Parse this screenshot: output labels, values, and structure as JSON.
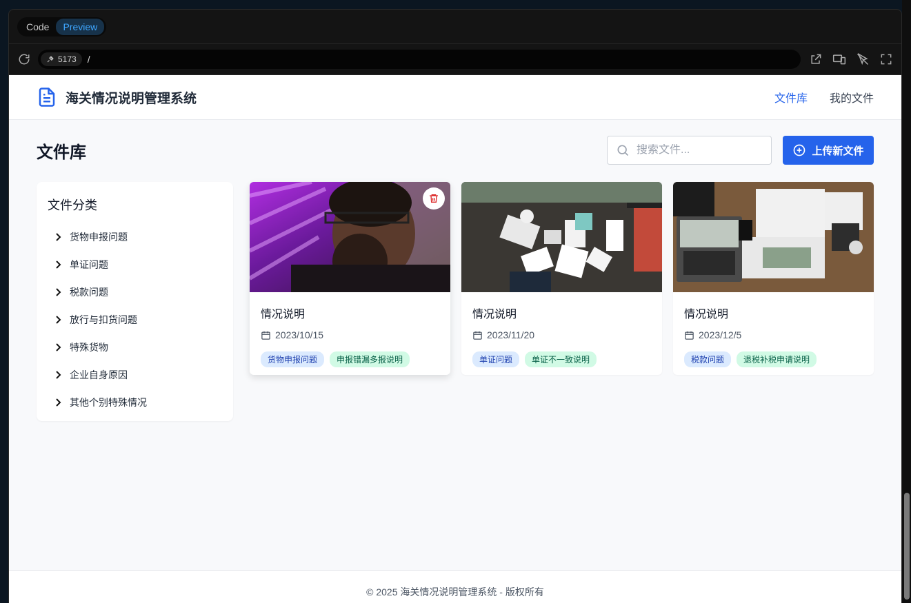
{
  "browser": {
    "tabs": [
      "Code",
      "Preview"
    ],
    "active_tab": "Preview",
    "port": "5173",
    "path": "/"
  },
  "header": {
    "title": "海关情况说明管理系统",
    "nav": [
      "文件库",
      "我的文件"
    ]
  },
  "page": {
    "title": "文件库",
    "search_placeholder": "搜索文件...",
    "upload_label": "上传新文件"
  },
  "sidebar": {
    "title": "文件分类",
    "items": [
      "货物申报问题",
      "单证问题",
      "税款问题",
      "放行与扣货问题",
      "特殊货物",
      "企业自身原因",
      "其他个别特殊情况"
    ]
  },
  "cards": [
    {
      "title": "情况说明",
      "date": "2023/10/15",
      "tags": [
        "货物申报问题",
        "申报错漏多报说明"
      ]
    },
    {
      "title": "情况说明",
      "date": "2023/11/20",
      "tags": [
        "单证问题",
        "单证不一致说明"
      ]
    },
    {
      "title": "情况说明",
      "date": "2023/12/5",
      "tags": [
        "税款问题",
        "退税补税申请说明"
      ]
    }
  ],
  "footer": "© 2025 海关情况说明管理系统 - 版权所有",
  "colors": {
    "accent": "#2563eb",
    "delete": "#dc2626"
  }
}
